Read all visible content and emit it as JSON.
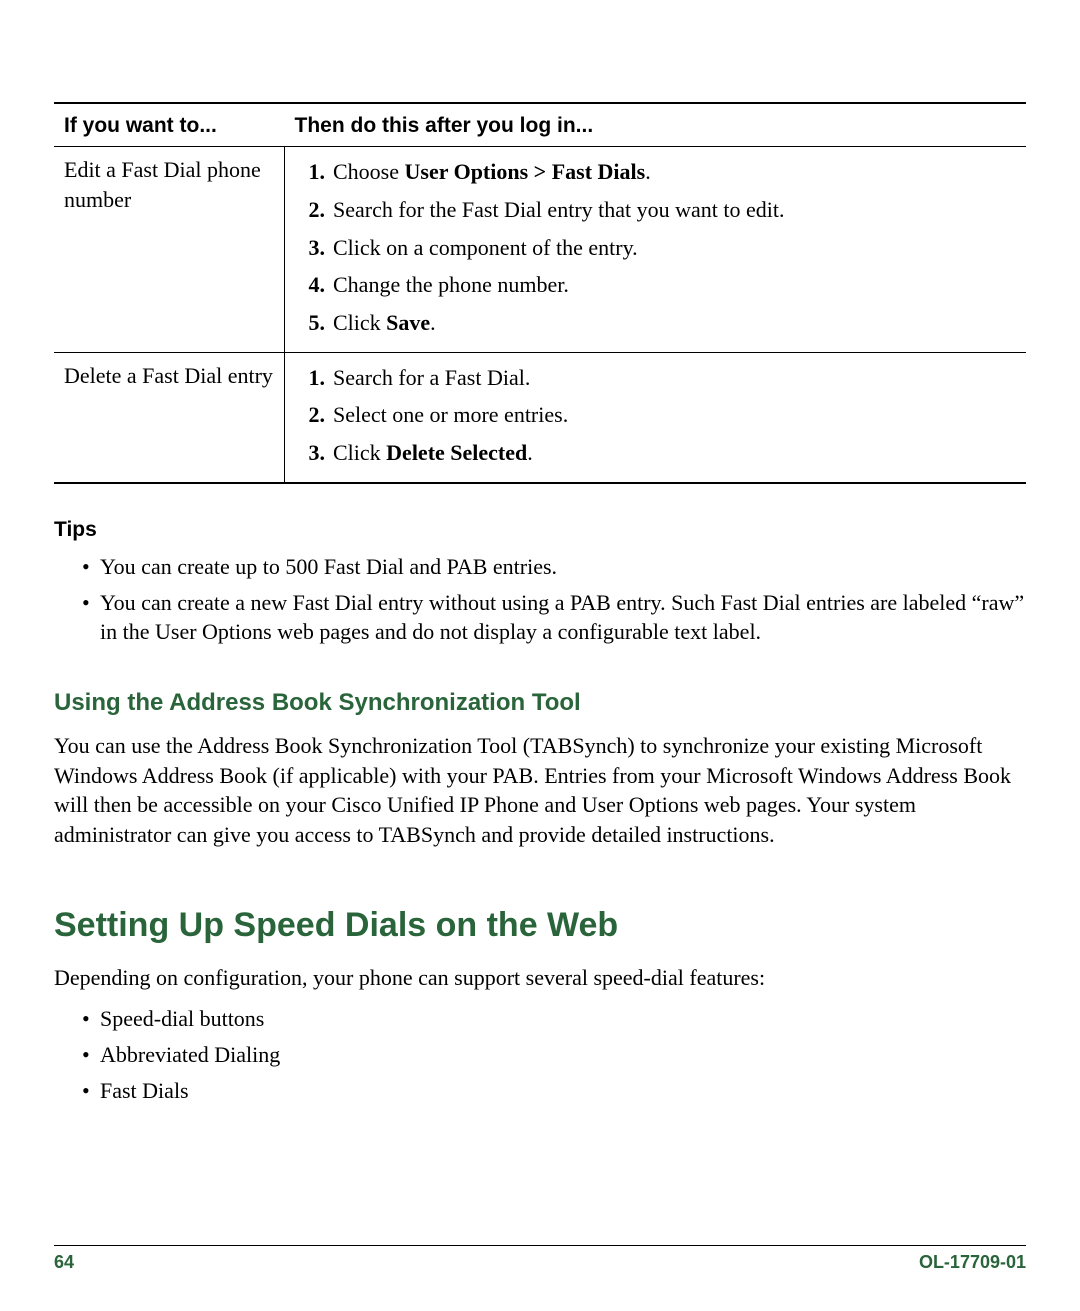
{
  "table": {
    "header": {
      "col1": "If you want to...",
      "col2": "Then do this after you log in..."
    },
    "rows": [
      {
        "task": "Edit a Fast Dial phone number",
        "steps": [
          {
            "pre": "Choose ",
            "bold": "User Options > Fast Dials",
            "post": "."
          },
          {
            "pre": "Search for the Fast Dial entry that you want to edit.",
            "bold": "",
            "post": ""
          },
          {
            "pre": "Click on a component of the entry.",
            "bold": "",
            "post": ""
          },
          {
            "pre": "Change the phone number.",
            "bold": "",
            "post": ""
          },
          {
            "pre": "Click ",
            "bold": "Save",
            "post": "."
          }
        ]
      },
      {
        "task": "Delete a Fast Dial entry",
        "steps": [
          {
            "pre": "Search for a Fast Dial.",
            "bold": "",
            "post": ""
          },
          {
            "pre": "Select one or more entries.",
            "bold": "",
            "post": ""
          },
          {
            "pre": "Click ",
            "bold": "Delete Selected",
            "post": "."
          }
        ]
      }
    ]
  },
  "tips": {
    "heading": "Tips",
    "items": [
      "You can create up to 500 Fast Dial and PAB entries.",
      "You can create a new Fast Dial entry without using a PAB entry. Such Fast Dial entries are labeled “raw” in the User Options web pages and do not display a configurable text label."
    ]
  },
  "sync": {
    "heading": "Using the Address Book Synchronization Tool",
    "body": "You can use the Address Book Synchronization Tool (TABSynch) to synchronize your existing Microsoft Windows Address Book (if applicable) with your PAB. Entries from your Microsoft Windows Address Book will then be accessible on your Cisco Unified IP Phone and User Options web pages. Your system administrator can give you access to TABSynch and provide detailed instructions."
  },
  "speed": {
    "heading": "Setting Up Speed Dials on the Web",
    "intro": "Depending on configuration, your phone can support several speed-dial features:",
    "items": [
      "Speed-dial buttons",
      "Abbreviated Dialing",
      "Fast Dials"
    ]
  },
  "footer": {
    "page": "64",
    "docid": "OL-17709-01"
  }
}
